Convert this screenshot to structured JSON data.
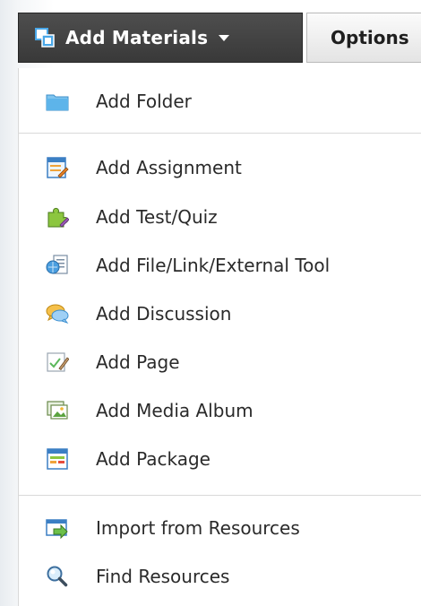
{
  "toolbar": {
    "add_materials_label": "Add Materials",
    "options_label": "Options"
  },
  "menu": {
    "group1": [
      {
        "label": "Add Folder",
        "icon": "folder-icon"
      }
    ],
    "group2": [
      {
        "label": "Add Assignment",
        "icon": "assignment-icon"
      },
      {
        "label": "Add Test/Quiz",
        "icon": "test-quiz-icon"
      },
      {
        "label": "Add File/Link/External Tool",
        "icon": "file-link-icon"
      },
      {
        "label": "Add Discussion",
        "icon": "discussion-icon"
      },
      {
        "label": "Add Page",
        "icon": "page-icon"
      },
      {
        "label": "Add Media Album",
        "icon": "media-album-icon"
      },
      {
        "label": "Add Package",
        "icon": "package-icon"
      }
    ],
    "group3": [
      {
        "label": "Import from Resources",
        "icon": "import-icon"
      },
      {
        "label": "Find Resources",
        "icon": "magnifier-icon"
      }
    ]
  },
  "colors": {
    "toolbar_dark": "#3d3d3d",
    "accent_blue": "#5aa9e6",
    "divider": "#d9d9d9"
  }
}
